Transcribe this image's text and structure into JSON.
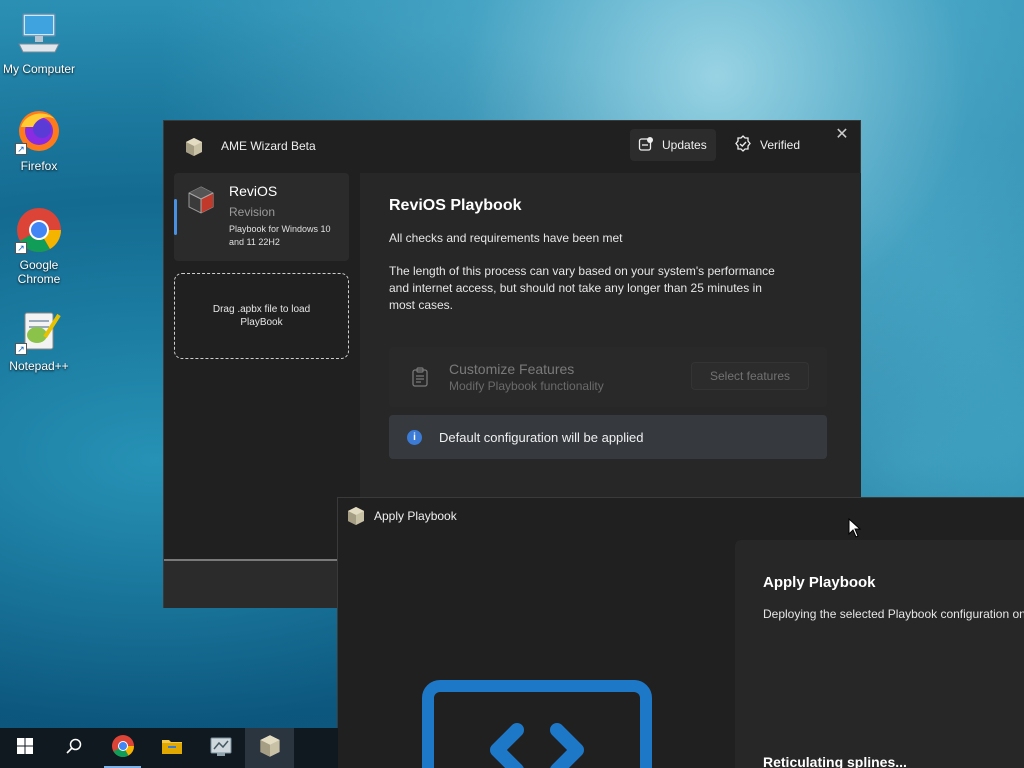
{
  "desktop": {
    "icons": [
      {
        "label": "My Computer",
        "icon": "computer-icon"
      },
      {
        "label": "Firefox",
        "icon": "firefox-icon"
      },
      {
        "label": "Google Chrome",
        "icon": "chrome-icon"
      },
      {
        "label": "Notepad++",
        "icon": "notepadpp-icon"
      }
    ]
  },
  "ame_window": {
    "title": "AME Wizard Beta",
    "updates_label": "Updates",
    "verified_label": "Verified",
    "sidebar": {
      "playbook_name": "ReviOS",
      "revision_label": "Revision",
      "description": "Playbook for Windows 10 and 11 22H2",
      "drop_zone_text": "Drag .apbx file to load PlayBook"
    },
    "main": {
      "heading": "ReviOS Playbook",
      "checks_text": "All checks and requirements have been met",
      "duration_text": "The length of this process can vary based on your system's performance and internet access, but should not take any longer than 25 minutes in most cases.",
      "features_title": "Customize Features",
      "features_subtitle": "Modify Playbook functionality",
      "select_features_label": "Select features",
      "info_text": "Default configuration will be applied"
    }
  },
  "apply_window": {
    "title": "Apply Playbook",
    "heading": "Apply Playbook",
    "description": "Deploying the selected Playbook configuration onto the system.",
    "status": "Reticulating splines..."
  },
  "taskbar": {
    "items": [
      "start-icon",
      "search-icon",
      "chrome-icon",
      "file-explorer-icon",
      "app-icon",
      "ame-wizard-icon"
    ],
    "active_index": 5
  },
  "colors": {
    "accent": "#4a90e2",
    "window_bg": "#202020",
    "panel_bg": "#272727",
    "info_blue": "#3b7bd6"
  }
}
